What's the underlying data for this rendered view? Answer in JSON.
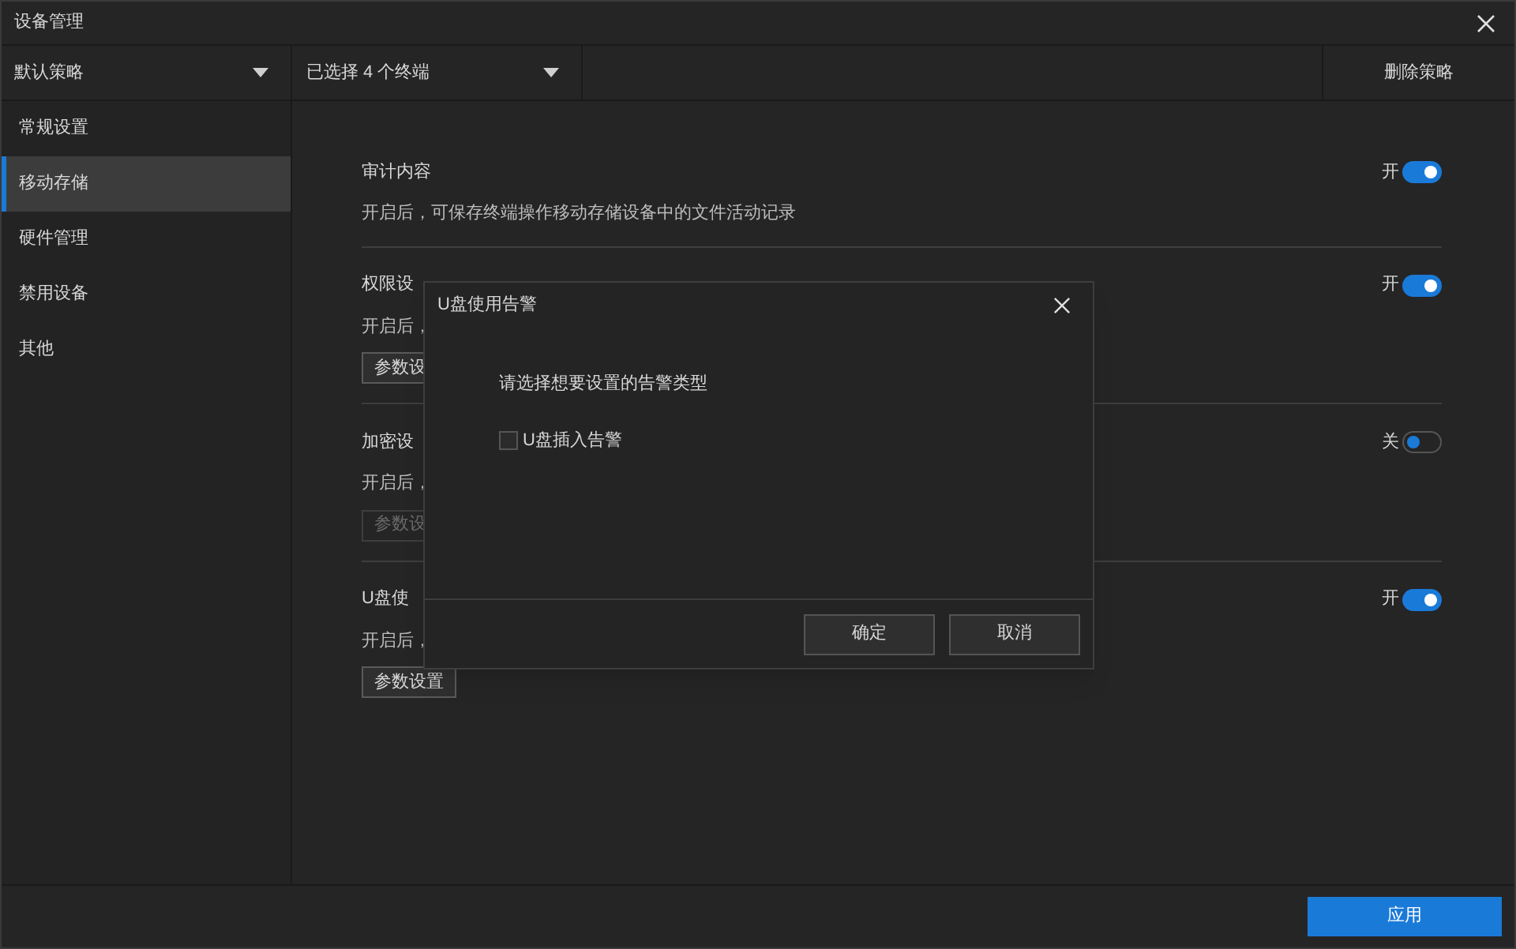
{
  "window": {
    "title": "设备管理"
  },
  "policy_select": {
    "value": "默认策略"
  },
  "terminal_select": {
    "value": "已选择 4 个终端"
  },
  "delete_button": "删除策略",
  "sidebar": {
    "items": [
      {
        "label": "常规设置",
        "selected": false
      },
      {
        "label": "移动存储",
        "selected": true
      },
      {
        "label": "硬件管理",
        "selected": false
      },
      {
        "label": "禁用设备",
        "selected": false
      },
      {
        "label": "其他",
        "selected": false
      }
    ]
  },
  "sections": [
    {
      "title": "审计内容",
      "description": "开启后，可保存终端操作移动存储设备中的文件活动记录",
      "toggle_label": "开",
      "on": true
    },
    {
      "title": "权限设",
      "description": "开启后，",
      "toggle_label": "开",
      "on": true,
      "button": {
        "label": "参数设",
        "disabled": false
      }
    },
    {
      "title": "加密设",
      "description": "开启后，",
      "toggle_label": "关",
      "on": false,
      "button": {
        "label": "参数设",
        "disabled": true
      }
    },
    {
      "title": "U盘使",
      "description": "开启后，",
      "toggle_label": "开",
      "on": true,
      "button": {
        "label": "参数设置",
        "disabled": false
      }
    }
  ],
  "apply_button": "应用",
  "dialog": {
    "title": "U盘使用告警",
    "prompt": "请选择想要设置的告警类型",
    "options": [
      {
        "label": "U盘插入告警",
        "checked": false
      }
    ],
    "buttons": [
      "确定",
      "取消"
    ]
  }
}
